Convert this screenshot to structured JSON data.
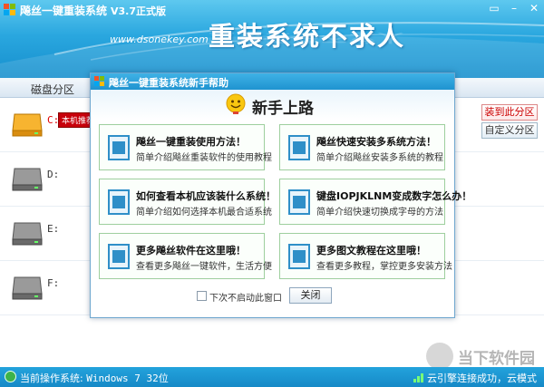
{
  "header": {
    "title": "飚丝一键重装系统",
    "version": "V3.7正式版",
    "url": "www.dsonekey.com",
    "slogan": "重装系统不求人"
  },
  "columns": {
    "partition": "磁盘分区"
  },
  "partitions": [
    {
      "label": "C:",
      "badge": "本机推荐"
    },
    {
      "label": "D:"
    },
    {
      "label": "E:"
    },
    {
      "label": "F:"
    }
  ],
  "side_buttons": {
    "install": "装到此分区",
    "custom": "自定义分区"
  },
  "dialog": {
    "title": "飚丝一键重装系统新手帮助",
    "heading": "新手上路",
    "cards": [
      {
        "title": "飚丝一键重装使用方法！",
        "desc": "简单介绍飚丝重装软件的使用教程"
      },
      {
        "title": "飚丝快速安装多系统方法！",
        "desc": "简单介绍飚丝安装多系统的教程"
      },
      {
        "title": "如何查看本机应该装什么系统！",
        "desc": "简单介绍如何选择本机最合适系统"
      },
      {
        "title": "键盘IOPJKLNM变成数字怎么办！",
        "desc": "简单介绍快速切换成字母的方法"
      },
      {
        "title": "更多飚丝软件在这里哦！",
        "desc": "查看更多飚丝一键软件，生活方便"
      },
      {
        "title": "更多图文教程在这里哦！",
        "desc": "查看更多教程，掌控更多安装方法"
      }
    ],
    "checkbox_label": "下次不启动此窗口",
    "close_label": "关闭"
  },
  "status": {
    "os_label": "当前操作系统:",
    "os_value": "Windows 7 32位",
    "right": "云引擎连接成功，云模式"
  },
  "watermark": "当下软件园",
  "colors": {
    "accent": "#1f93d0",
    "badge": "#c8000b",
    "card_border": "#9ecf9e"
  }
}
